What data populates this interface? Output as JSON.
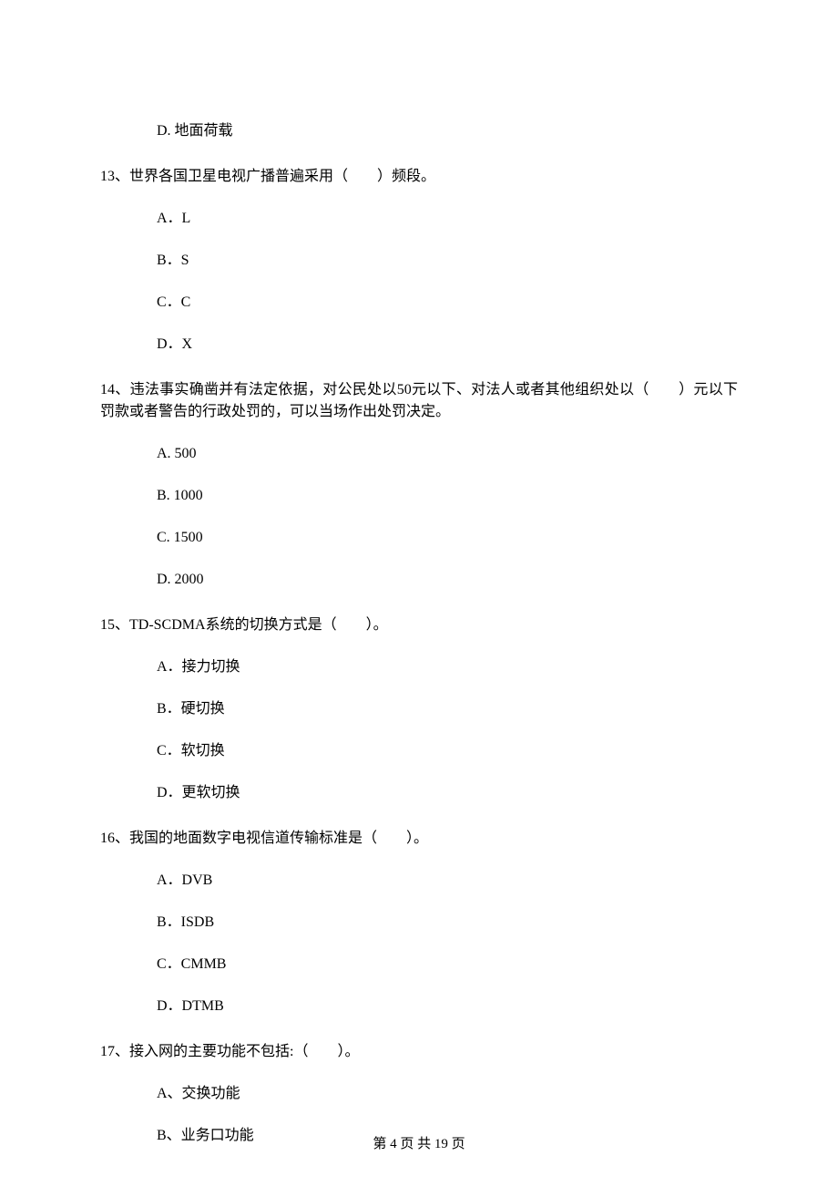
{
  "items": [
    {
      "type": "option",
      "text": "D.  地面荷载"
    },
    {
      "type": "question",
      "text": "13、世界各国卫星电视广播普遍采用（　　）频段。"
    },
    {
      "type": "option",
      "text": "A．L"
    },
    {
      "type": "option",
      "text": "B．S"
    },
    {
      "type": "option",
      "text": "C．C"
    },
    {
      "type": "option",
      "text": "D．X"
    },
    {
      "type": "question",
      "text": "14、违法事实确凿并有法定依据，对公民处以50元以下、对法人或者其他组织处以（　　）元以下罚款或者警告的行政处罚的，可以当场作出处罚决定。"
    },
    {
      "type": "option",
      "text": "A.  500"
    },
    {
      "type": "option",
      "text": "B.  1000"
    },
    {
      "type": "option",
      "text": "C.  1500"
    },
    {
      "type": "option",
      "text": "D.  2000"
    },
    {
      "type": "question",
      "text": "15、TD-SCDMA系统的切换方式是（　　）。"
    },
    {
      "type": "option",
      "text": "A．接力切换"
    },
    {
      "type": "option",
      "text": "B．硬切换"
    },
    {
      "type": "option",
      "text": "C．软切换"
    },
    {
      "type": "option",
      "text": "D．更软切换"
    },
    {
      "type": "question",
      "text": "16、我国的地面数字电视信道传输标准是（　　）。"
    },
    {
      "type": "option",
      "text": "A．DVB"
    },
    {
      "type": "option",
      "text": "B．ISDB"
    },
    {
      "type": "option",
      "text": "C．CMMB"
    },
    {
      "type": "option",
      "text": "D．DTMB"
    },
    {
      "type": "question",
      "text": "17、接入网的主要功能不包括:（　　）。"
    },
    {
      "type": "option",
      "text": "A、交换功能"
    },
    {
      "type": "option",
      "text": "B、业务口功能"
    }
  ],
  "footer": "第 4 页 共 19 页"
}
